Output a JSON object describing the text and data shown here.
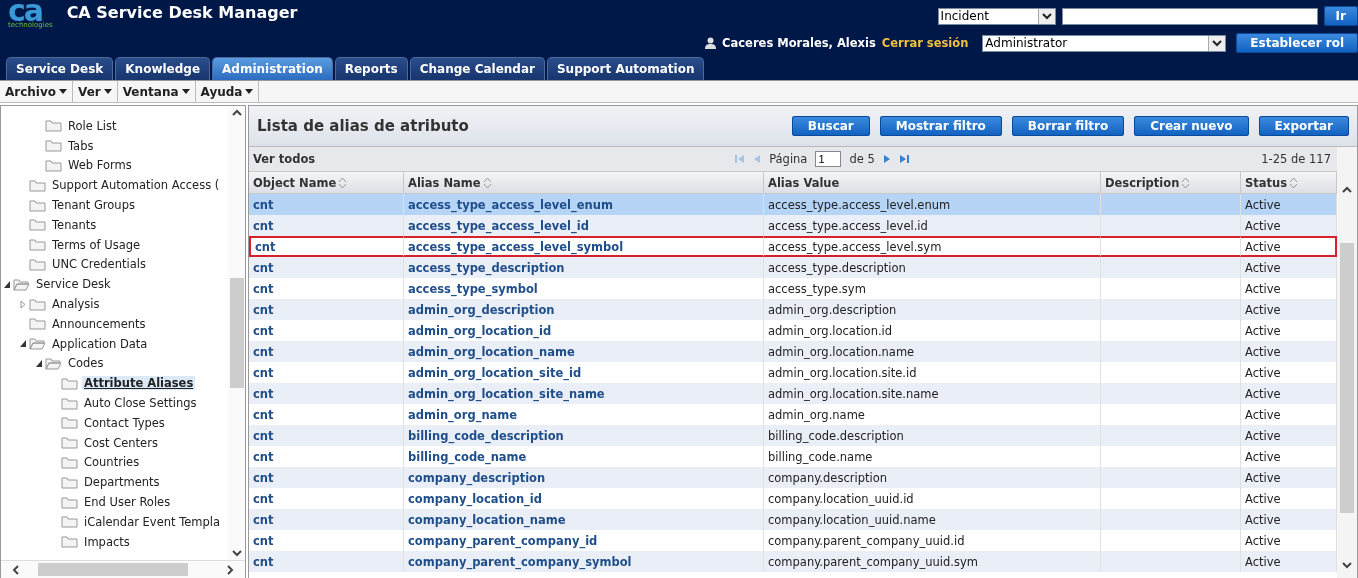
{
  "header": {
    "logo": {
      "mark": "ca",
      "tagline": "technologies"
    },
    "title": "CA Service Desk Manager",
    "search_type": {
      "value": "Incident"
    },
    "go_button": "Ir",
    "user": "Caceres Morales, Alexis",
    "logout": "Cerrar sesión",
    "role": {
      "value": "Administrator"
    },
    "set_role_button": "Establecer rol"
  },
  "tabs": [
    {
      "label": "Service Desk",
      "selected": false
    },
    {
      "label": "Knowledge",
      "selected": false
    },
    {
      "label": "Administration",
      "selected": true
    },
    {
      "label": "Reports",
      "selected": false
    },
    {
      "label": "Change Calendar",
      "selected": false
    },
    {
      "label": "Support Automation",
      "selected": false
    }
  ],
  "menu": [
    "Archivo",
    "Ver",
    "Ventana",
    "Ayuda"
  ],
  "tree": [
    {
      "children": [
        {
          "children": [
            {
              "label": "Role List",
              "selected": false
            },
            {
              "label": "Tabs",
              "selected": false
            },
            {
              "label": "Web Forms",
              "selected": false
            }
          ]
        },
        {
          "label": "Support Automation Access (",
          "selected": false
        },
        {
          "label": "Tenant Groups",
          "selected": false
        },
        {
          "label": "Tenants",
          "selected": false
        },
        {
          "label": "Terms of Usage",
          "selected": false
        },
        {
          "label": "UNC Credentials",
          "selected": false
        }
      ]
    },
    {
      "label": "Service Desk",
      "selected": false,
      "expanded": true,
      "children": [
        {
          "label": "Analysis",
          "selected": false,
          "expanded": false
        },
        {
          "label": "Announcements",
          "selected": false
        },
        {
          "label": "Application Data",
          "selected": false,
          "expanded": true,
          "children": [
            {
              "label": "Codes",
              "selected": false,
              "expanded": true,
              "children": [
                {
                  "label": "Attribute Aliases",
                  "selected": true
                },
                {
                  "label": "Auto Close Settings",
                  "selected": false
                },
                {
                  "label": "Contact Types",
                  "selected": false
                },
                {
                  "label": "Cost Centers",
                  "selected": false
                },
                {
                  "label": "Countries",
                  "selected": false
                },
                {
                  "label": "Departments",
                  "selected": false
                },
                {
                  "label": "End User Roles",
                  "selected": false
                },
                {
                  "label": "iCalendar Event Templa",
                  "selected": false
                },
                {
                  "label": "Impacts",
                  "selected": false
                }
              ]
            }
          ]
        }
      ]
    }
  ],
  "list": {
    "title": "Lista de alias de atributo",
    "buttons": [
      "Buscar",
      "Mostrar filtro",
      "Borrar filtro",
      "Crear nuevo",
      "Exportar"
    ],
    "show_all": "Ver todos",
    "page_label": "Página",
    "page": "1",
    "page_total": "de 5",
    "range": "1-25 de 117",
    "columns": [
      {
        "label": "Object Name",
        "sortable": true
      },
      {
        "label": "Alias Name",
        "sortable": true
      },
      {
        "label": "Alias Value",
        "sortable": false
      },
      {
        "label": "Description",
        "sortable": true
      },
      {
        "label": "Status",
        "sortable": true
      }
    ],
    "rows": [
      {
        "cells": [
          "cnt",
          "access_type_access_level_enum",
          "access_type.access_level.enum",
          "",
          "Active"
        ],
        "selected": true,
        "marked": false
      },
      {
        "cells": [
          "cnt",
          "access_type_access_level_id",
          "access_type.access_level.id",
          "",
          "Active"
        ],
        "selected": false,
        "marked": false
      },
      {
        "cells": [
          "cnt",
          "access_type_access_level_symbol",
          "access_type.access_level.sym",
          "",
          "Active"
        ],
        "selected": false,
        "marked": true
      },
      {
        "cells": [
          "cnt",
          "access_type_description",
          "access_type.description",
          "",
          "Active"
        ],
        "selected": false,
        "marked": false
      },
      {
        "cells": [
          "cnt",
          "access_type_symbol",
          "access_type.sym",
          "",
          "Active"
        ],
        "selected": false,
        "marked": false
      },
      {
        "cells": [
          "cnt",
          "admin_org_description",
          "admin_org.description",
          "",
          "Active"
        ],
        "selected": false,
        "marked": false
      },
      {
        "cells": [
          "cnt",
          "admin_org_location_id",
          "admin_org.location.id",
          "",
          "Active"
        ],
        "selected": false,
        "marked": false
      },
      {
        "cells": [
          "cnt",
          "admin_org_location_name",
          "admin_org.location.name",
          "",
          "Active"
        ],
        "selected": false,
        "marked": false
      },
      {
        "cells": [
          "cnt",
          "admin_org_location_site_id",
          "admin_org.location.site.id",
          "",
          "Active"
        ],
        "selected": false,
        "marked": false
      },
      {
        "cells": [
          "cnt",
          "admin_org_location_site_name",
          "admin_org.location.site.name",
          "",
          "Active"
        ],
        "selected": false,
        "marked": false
      },
      {
        "cells": [
          "cnt",
          "admin_org_name",
          "admin_org.name",
          "",
          "Active"
        ],
        "selected": false,
        "marked": false
      },
      {
        "cells": [
          "cnt",
          "billing_code_description",
          "billing_code.description",
          "",
          "Active"
        ],
        "selected": false,
        "marked": false
      },
      {
        "cells": [
          "cnt",
          "billing_code_name",
          "billing_code.name",
          "",
          "Active"
        ],
        "selected": false,
        "marked": false
      },
      {
        "cells": [
          "cnt",
          "company_description",
          "company.description",
          "",
          "Active"
        ],
        "selected": false,
        "marked": false
      },
      {
        "cells": [
          "cnt",
          "company_location_id",
          "company.location_uuid.id",
          "",
          "Active"
        ],
        "selected": false,
        "marked": false
      },
      {
        "cells": [
          "cnt",
          "company_location_name",
          "company.location_uuid.name",
          "",
          "Active"
        ],
        "selected": false,
        "marked": false
      },
      {
        "cells": [
          "cnt",
          "company_parent_company_id",
          "company.parent_company_uuid.id",
          "",
          "Active"
        ],
        "selected": false,
        "marked": false
      },
      {
        "cells": [
          "cnt",
          "company_parent_company_symbol",
          "company.parent_company_uuid.sym",
          "",
          "Active"
        ],
        "selected": false,
        "marked": false
      }
    ]
  }
}
